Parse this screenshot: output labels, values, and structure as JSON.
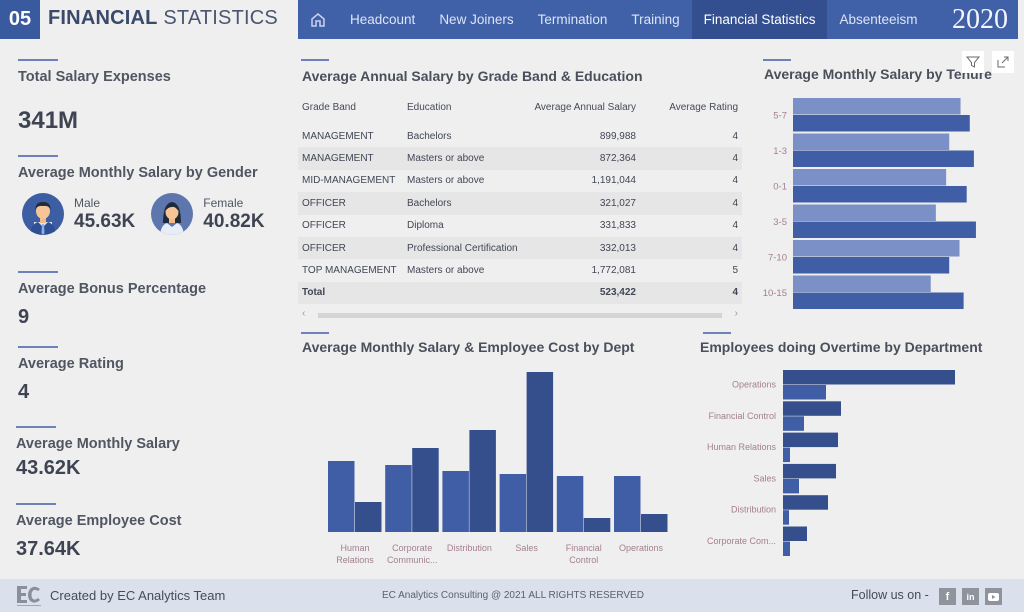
{
  "header": {
    "page_number": "05",
    "title_bold": "FINANCIAL",
    "title_light": "STATISTICS",
    "nav_items": [
      {
        "label": "Headcount",
        "active": false
      },
      {
        "label": "New Joiners",
        "active": false
      },
      {
        "label": "Termination",
        "active": false
      },
      {
        "label": "Training",
        "active": false
      },
      {
        "label": "Financial Statistics",
        "active": true
      },
      {
        "label": "Absenteeism",
        "active": false
      }
    ],
    "year": "2020"
  },
  "kpis": {
    "total_salary": {
      "title": "Total Salary Expenses",
      "value": "341M"
    },
    "gender": {
      "title": "Average Monthly Salary by Gender",
      "male": {
        "label": "Male",
        "value": "45.63K"
      },
      "female": {
        "label": "Female",
        "value": "40.82K"
      }
    },
    "bonus": {
      "title": "Average Bonus Percentage",
      "value": "9"
    },
    "rating": {
      "title": "Average Rating",
      "value": "4"
    },
    "monthly_salary": {
      "title": "Average Monthly Salary",
      "value": "43.62K"
    },
    "employee_cost": {
      "title": "Average Employee Cost",
      "value": "37.64K"
    }
  },
  "salary_table": {
    "title": "Average Annual Salary by Grade Band & Education",
    "columns": [
      "Grade Band",
      "Education",
      "Average Annual Salary",
      "Average Rating"
    ],
    "rows": [
      [
        "MANAGEMENT",
        "Bachelors",
        "899,988",
        "4"
      ],
      [
        "MANAGEMENT",
        "Masters or above",
        "872,364",
        "4"
      ],
      [
        "MID-MANAGEMENT",
        "Masters or above",
        "1,191,044",
        "4"
      ],
      [
        "OFFICER",
        "Bachelors",
        "321,027",
        "4"
      ],
      [
        "OFFICER",
        "Diploma",
        "331,833",
        "4"
      ],
      [
        "OFFICER",
        "Professional Certification",
        "332,013",
        "4"
      ],
      [
        "TOP MANAGEMENT",
        "Masters or above",
        "1,772,081",
        "5"
      ]
    ],
    "total": [
      "Total",
      "",
      "523,422",
      "4"
    ]
  },
  "colors": {
    "primary": "#3f5ea6",
    "dark": "#344f8c",
    "light": "#7a90c6",
    "nav_bg": "#4060a8",
    "nav_active": "#334f8f",
    "axis_label": "#a28090"
  },
  "chart_data": [
    {
      "type": "bar",
      "orientation": "horizontal",
      "title": "Average Monthly Salary by Tenure",
      "categories": [
        "5-7",
        "1-3",
        "0-1",
        "3-5",
        "7-10",
        "10-15"
      ],
      "series": [
        {
          "name": "Series 1",
          "values": [
            163,
            152,
            149,
            139,
            162,
            134
          ]
        },
        {
          "name": "Series 2",
          "values": [
            172,
            176,
            169,
            178,
            152,
            166
          ]
        }
      ],
      "xlim": [
        0,
        180
      ],
      "note": "no axis shown; values are relative magnitudes"
    },
    {
      "type": "bar",
      "orientation": "vertical",
      "title": "Average Monthly Salary & Employee Cost by Dept",
      "categories": [
        "Human Relations",
        "Corporate Communic...",
        "Distribution",
        "Sales",
        "Financial Control",
        "Operations"
      ],
      "series": [
        {
          "name": "Average Monthly Salary",
          "values": [
            71,
            67,
            61,
            58,
            56,
            56
          ]
        },
        {
          "name": "Employee Cost",
          "values": [
            30,
            84,
            102,
            160,
            14,
            18
          ]
        }
      ],
      "ylim": [
        0,
        165
      ],
      "note": "no axis shown; values are relative magnitudes"
    },
    {
      "type": "bar",
      "orientation": "horizontal",
      "title": "Employees doing Overtime by Department",
      "categories": [
        "Operations",
        "Financial Control",
        "Human Relations",
        "Sales",
        "Distribution",
        "Corporate Com..."
      ],
      "series": [
        {
          "name": "Series 1",
          "values": [
            172,
            58,
            55,
            53,
            45,
            24
          ]
        },
        {
          "name": "Series 2",
          "values": [
            43,
            21,
            7,
            16,
            6,
            7
          ]
        }
      ],
      "xlim": [
        0,
        180
      ],
      "note": "no axis shown; values are relative magnitudes"
    }
  ],
  "footer": {
    "created_by": "Created by EC Analytics Team",
    "copyright": "EC Analytics Consulting @ 2021 ALL RIGHTS RESERVED",
    "follow": "Follow us on -",
    "social": [
      "facebook",
      "linkedin",
      "youtube"
    ]
  }
}
